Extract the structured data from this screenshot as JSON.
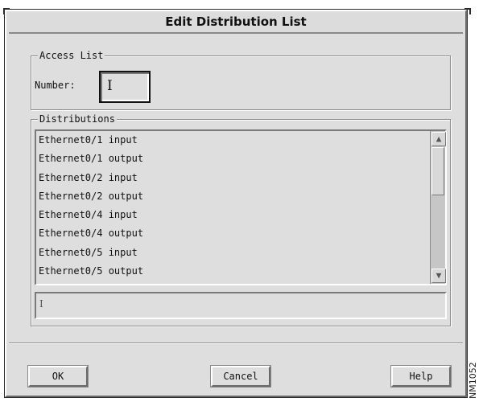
{
  "dialog": {
    "title": "Edit Distribution List"
  },
  "access_list": {
    "group_label": "Access List",
    "number_label": "Number:",
    "number_value": "",
    "cursor_glyph": "I"
  },
  "distributions": {
    "group_label": "Distributions",
    "items": [
      "Ethernet0/1 input",
      "Ethernet0/1 output",
      "Ethernet0/2 input",
      "Ethernet0/2 output",
      "Ethernet0/4 input",
      "Ethernet0/4 output",
      "Ethernet0/5 input",
      "Ethernet0/5 output"
    ],
    "selection_value": "",
    "selection_cursor_glyph": "I",
    "scroll_up_glyph": "▲",
    "scroll_down_glyph": "▼"
  },
  "buttons": {
    "ok": "OK",
    "cancel": "Cancel",
    "help": "Help"
  },
  "figure_id": "NM1052",
  "icons": {
    "scroll_up": "scroll-up-arrow-icon",
    "scroll_down": "scroll-down-arrow-icon",
    "text_cursor": "text-cursor-icon"
  },
  "colors": {
    "dialog_bg": "#dedede",
    "border_dark": "#6a6a6a",
    "border_light": "#ffffff",
    "text": "#111111"
  }
}
